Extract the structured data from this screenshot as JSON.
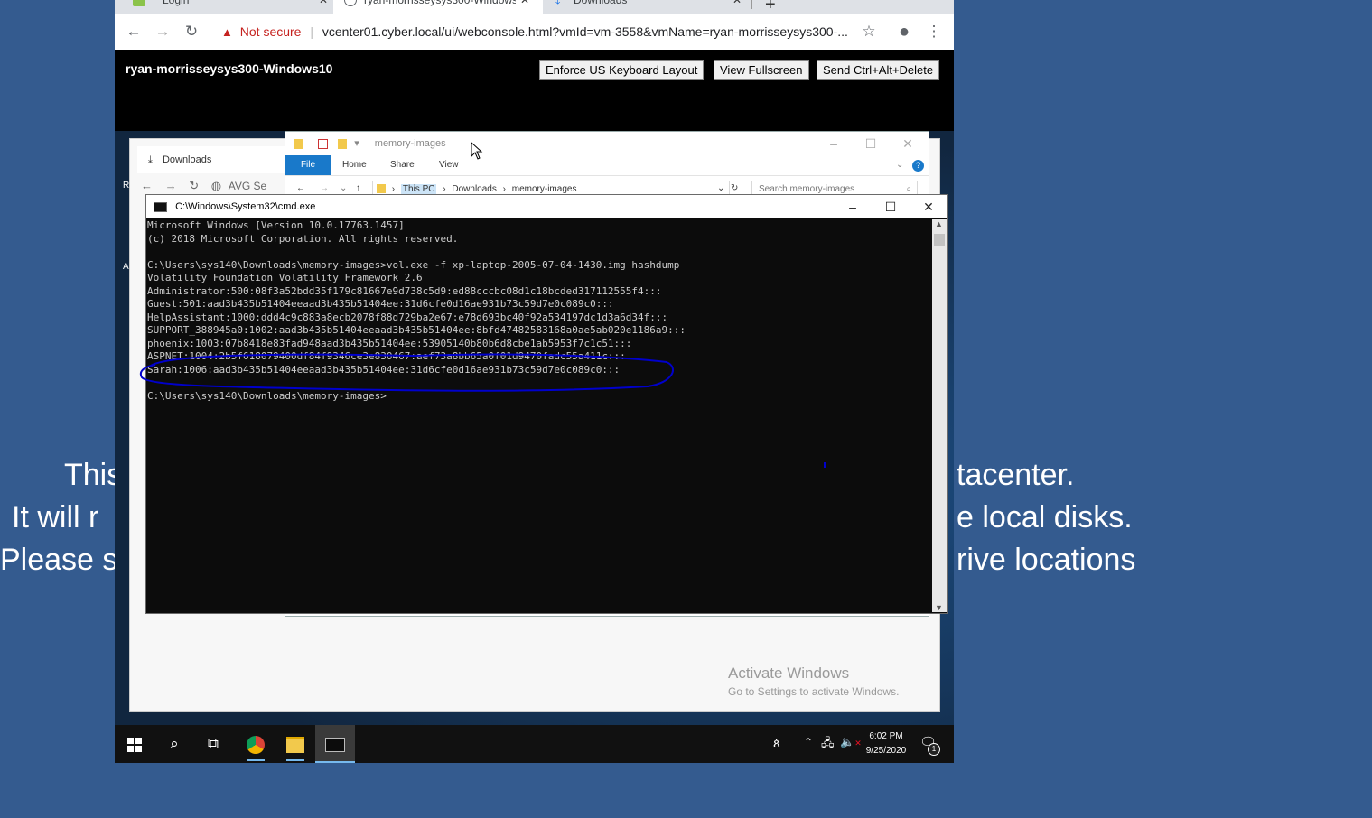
{
  "background": {
    "color": "#345b8f",
    "lines_left": [
      "This",
      "It will r",
      "Please s"
    ],
    "lines_right": [
      "tacenter.",
      "e local disks.",
      "rive locations"
    ]
  },
  "browser": {
    "tabs": [
      {
        "label": "Login",
        "icon": "vpn-icon",
        "active": false
      },
      {
        "label": "ryan-morrisseysys300-Windows",
        "icon": "globe-icon",
        "active": true
      },
      {
        "label": "Downloads",
        "icon": "download-icon",
        "active": false
      }
    ],
    "close_glyph": "✕",
    "new_tab_glyph": "+",
    "security_label": "Not secure",
    "url": "vcenter01.cyber.local/ui/webconsole.html?vmId=vm-3558&vmName=ryan-morrisseysys300-...",
    "icons": {
      "back": "←",
      "forward": "→",
      "reload": "↻",
      "warning": "▲",
      "star": "☆",
      "account": "●",
      "menu": "⋮"
    }
  },
  "console": {
    "vm_name": "ryan-morrisseysys300-Windows10",
    "buttons": [
      "Enforce US Keyboard Layout",
      "View Fullscreen",
      "Send Ctrl+Alt+Delete"
    ]
  },
  "edge_window": {
    "tab_label": "Downloads",
    "address_fragment": "AVG Se",
    "side_letters": [
      "R",
      "A"
    ]
  },
  "explorer": {
    "title": "memory-images",
    "ribbon_tabs": [
      "File",
      "Home",
      "Share",
      "View"
    ],
    "breadcrumb": [
      "This PC",
      "Downloads",
      "memory-images"
    ],
    "search_placeholder": "Search memory-images"
  },
  "cmd": {
    "title": "C:\\Windows\\System32\\cmd.exe",
    "lines": [
      "Microsoft Windows [Version 10.0.17763.1457]",
      "(c) 2018 Microsoft Corporation. All rights reserved.",
      "",
      "C:\\Users\\sys140\\Downloads\\memory-images>vol.exe -f xp-laptop-2005-07-04-1430.img hashdump",
      "Volatility Foundation Volatility Framework 2.6",
      "Administrator:500:08f3a52bdd35f179c81667e9d738c5d9:ed88cccbc08d1c18bcded317112555f4:::",
      "Guest:501:aad3b435b51404eeaad3b435b51404ee:31d6cfe0d16ae931b73c59d7e0c089c0:::",
      "HelpAssistant:1000:ddd4c9c883a8ecb2078f88d729ba2e67:e78d693bc40f92a534197dc1d3a6d34f:::",
      "SUPPORT_388945a0:1002:aad3b435b51404eeaad3b435b51404ee:8bfd47482583168a0ae5ab020e1186a9:::",
      "phoenix:1003:07b8418e83fad948aad3b435b51404ee:53905140b80b6d8cbe1ab5953f7c1c51:::",
      "ASPNET:1004:2b5f618079400df84f9346ce3e830467:aef73a8bb65a0f01d9470fadc55a411c:::",
      "Sarah:1006:aad3b435b51404eeaad3b435b51404ee:31d6cfe0d16ae931b73c59d7e0c089c0:::",
      "",
      "C:\\Users\\sys140\\Downloads\\memory-images>"
    ],
    "annotation_color": "#0000cc"
  },
  "watermark": {
    "title": "Activate Windows",
    "subtitle": "Go to Settings to activate Windows."
  },
  "taskbar": {
    "time": "6:02 PM",
    "date": "9/25/2020",
    "notification_count": "1",
    "icons": [
      "windows-start-icon",
      "search-icon",
      "task-view-icon",
      "chrome-icon",
      "file-explorer-icon",
      "cmd-icon"
    ]
  }
}
